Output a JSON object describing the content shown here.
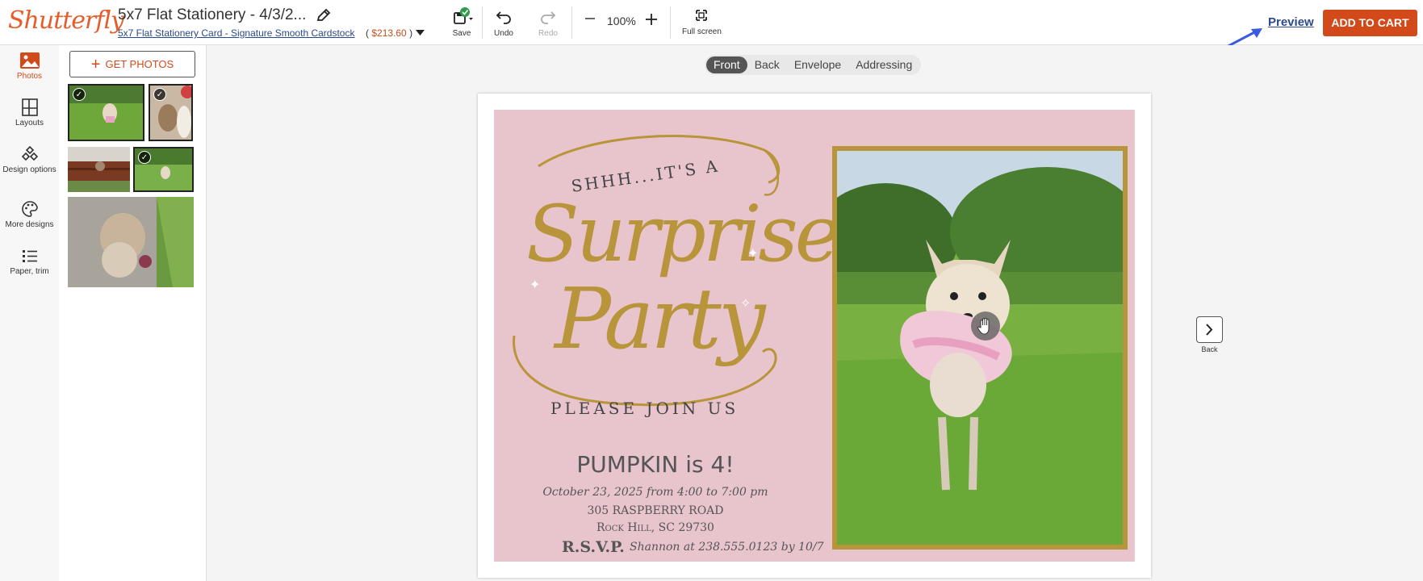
{
  "header": {
    "logo": "Shutterfly",
    "project_title": "5x7 Flat Stationery - 4/3/2...",
    "product_link": "5x7 Flat Stationery Card - Signature Smooth Cardstock",
    "price_open": "(",
    "price": "$213.60",
    "price_close": ")",
    "tools": {
      "save": "Save",
      "undo": "Undo",
      "redo": "Redo",
      "zoom": "100%",
      "fullscreen": "Full screen"
    },
    "preview": "Preview",
    "add_to_cart": "ADD TO CART"
  },
  "rail": {
    "items": [
      {
        "label": "Photos",
        "icon": "photo-icon",
        "active": true
      },
      {
        "label": "Layouts",
        "icon": "layouts-icon"
      },
      {
        "label": "Design options",
        "icon": "design-options-icon"
      },
      {
        "label": "More designs",
        "icon": "palette-icon"
      },
      {
        "label": "Paper, trim",
        "icon": "list-icon"
      }
    ]
  },
  "panel": {
    "get_photos": "GET PHOTOS"
  },
  "canvas": {
    "tabs": [
      "Front",
      "Back",
      "Envelope",
      "Addressing"
    ],
    "active_tab": "Front",
    "next_label": "Back"
  },
  "card": {
    "line1": "SHHH...IT'S A",
    "line2": "Surprise",
    "line3": "Party",
    "line4": "PLEASE JOIN US",
    "headline": "PUMPKIN is 4!",
    "date": "October 23, 2025 from 4:00 to 7:00 pm",
    "address1": "305 RASPBERRY ROAD",
    "address2": "Rock Hill, SC 29730",
    "rsvp": "R.S.V.P.",
    "rsvp_detail": "Shannon at 238.555.0123 by 10/7"
  },
  "colors": {
    "brand": "#e65c2b",
    "cta": "#d24a1a",
    "card_pink": "#e8c5cc",
    "gold": "#b8943a",
    "link": "#2a4a8a"
  }
}
